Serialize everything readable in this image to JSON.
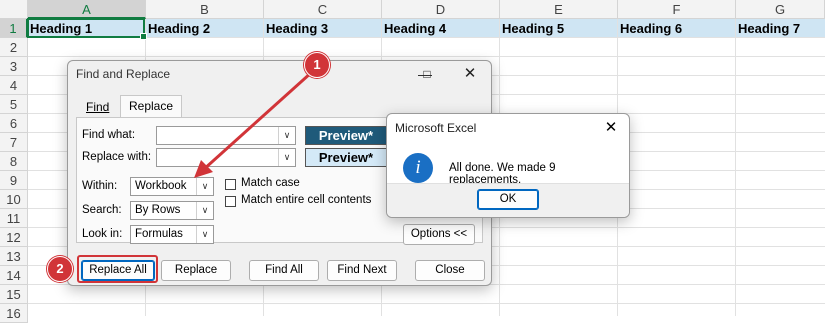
{
  "sheet": {
    "columns": [
      "A",
      "B",
      "C",
      "D",
      "E",
      "F",
      "G"
    ],
    "rows": [
      "1",
      "2",
      "3",
      "4",
      "5",
      "6",
      "7",
      "8",
      "9",
      "10",
      "11",
      "12",
      "13",
      "14",
      "15",
      "16"
    ],
    "row1": [
      "Heading 1",
      "Heading 2",
      "Heading 3",
      "Heading 4",
      "Heading 5",
      "Heading 6",
      "Heading 7"
    ]
  },
  "find_replace": {
    "title": "Find and Replace",
    "tabs": [
      "Find",
      "Replace"
    ],
    "find_what_label": "Find what:",
    "replace_with_label": "Replace with:",
    "find_what_value": "",
    "replace_with_value": "",
    "preview_find": "Preview*",
    "preview_replace": "Preview*",
    "within_label": "Within:",
    "within_value": "Workbook",
    "search_label": "Search:",
    "search_value": "By Rows",
    "lookin_label": "Look in:",
    "lookin_value": "Formulas",
    "match_case": "Match case",
    "match_entire": "Match entire cell contents",
    "options_button": "Options <<",
    "buttons": {
      "replace_all": "Replace All",
      "replace": "Replace",
      "find_all": "Find All",
      "find_next": "Find Next",
      "close": "Close"
    }
  },
  "message_box": {
    "title": "Microsoft Excel",
    "message": "All done. We made 9 replacements.",
    "ok": "OK",
    "icon": "info-icon"
  },
  "annotations": {
    "step1": "1",
    "step2": "2",
    "color": "#d13438"
  }
}
